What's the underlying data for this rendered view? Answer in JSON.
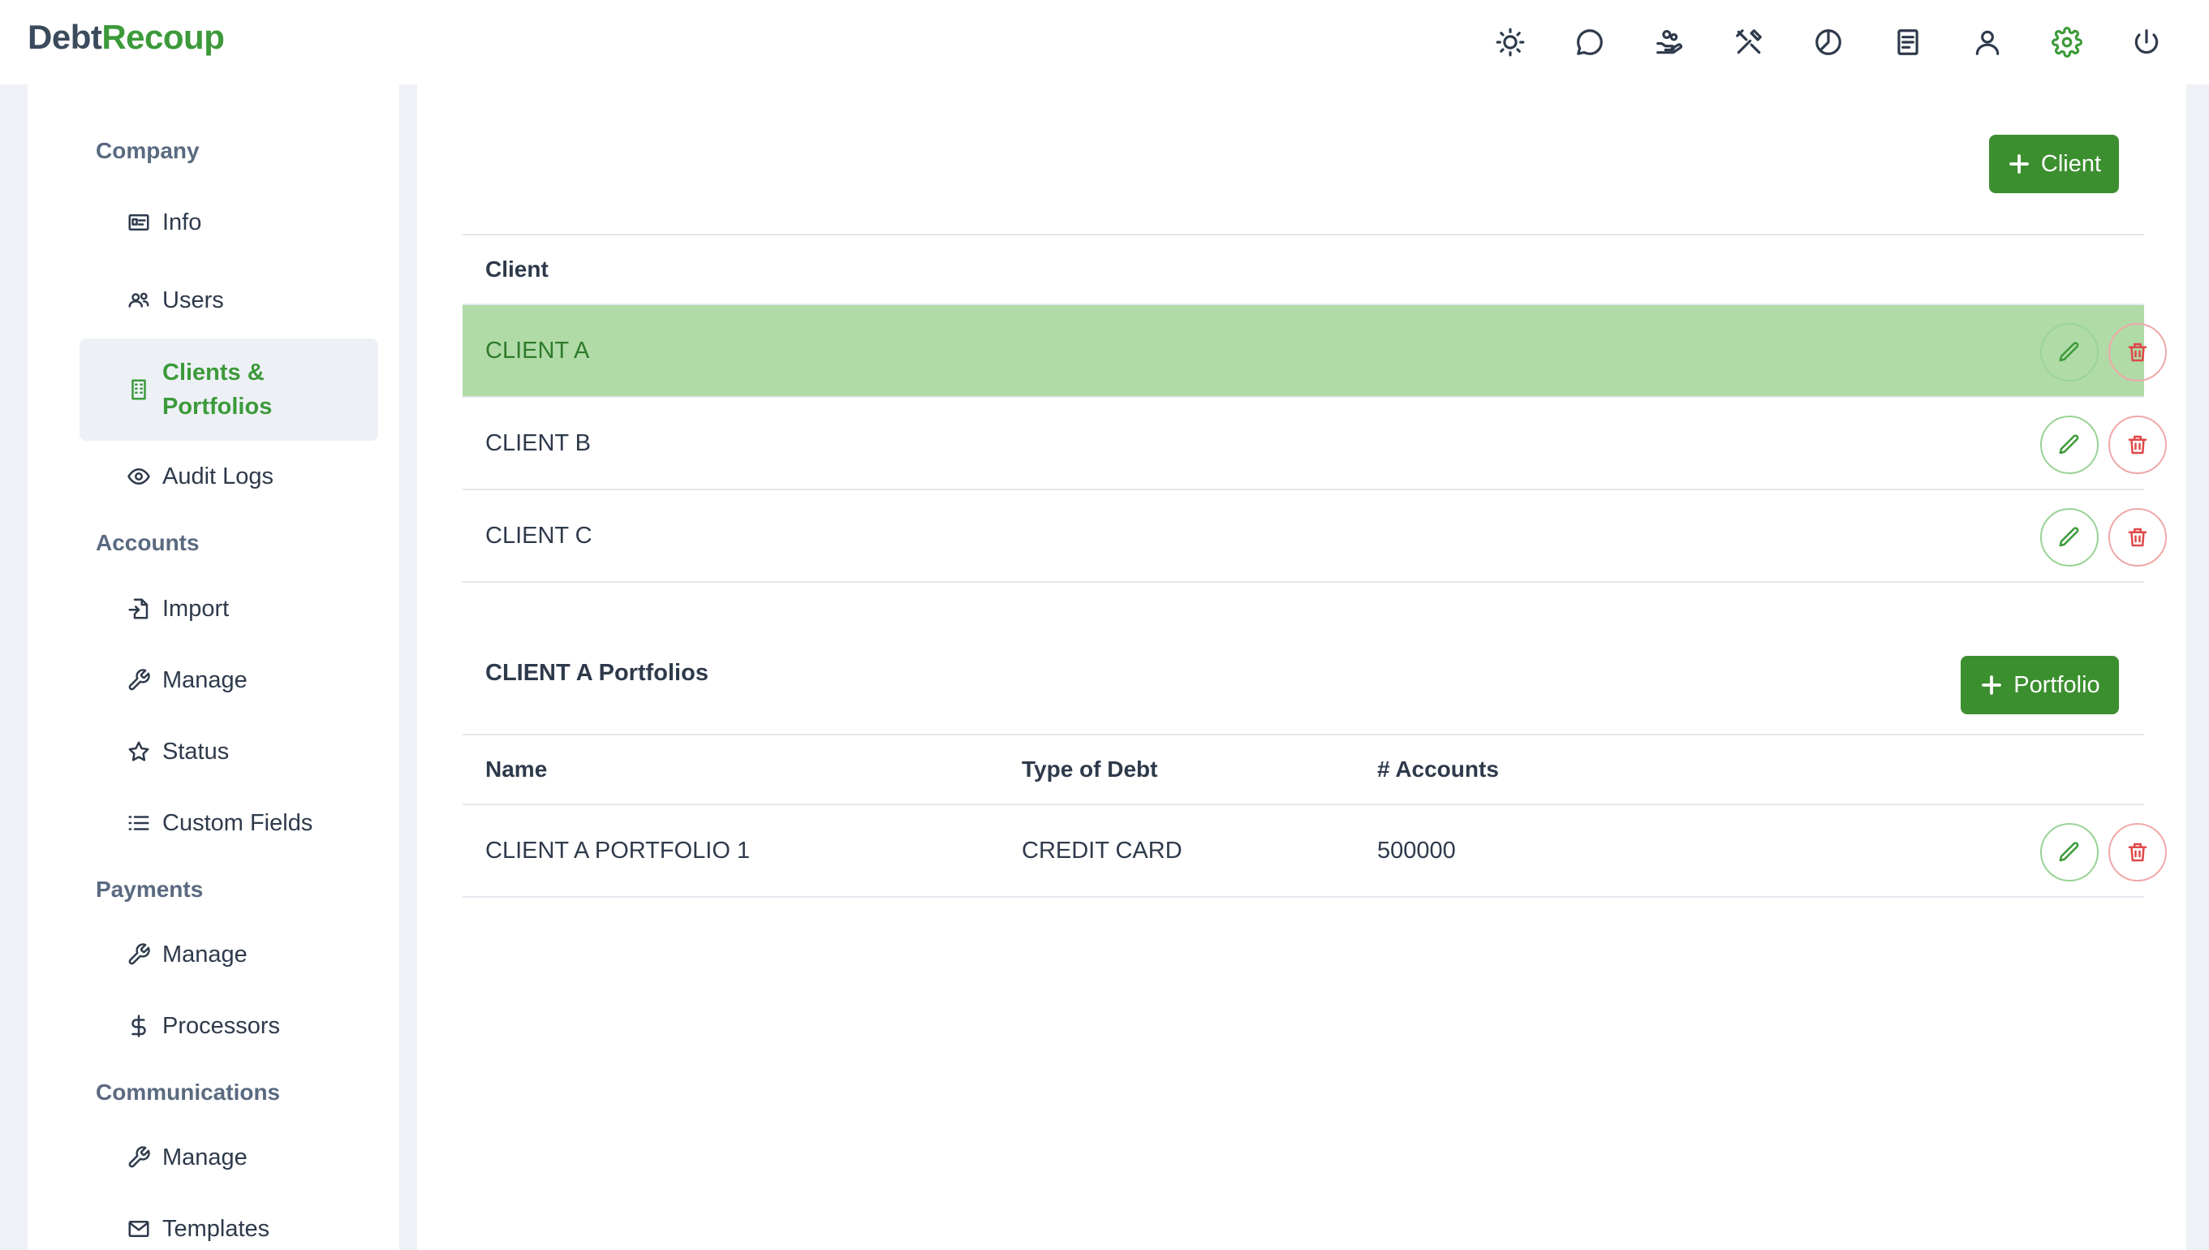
{
  "app": {
    "logo_part1": "Debt",
    "logo_part2": "Recoup"
  },
  "header_icons": [
    "sun-icon",
    "chat-icon",
    "hand-coins-icon",
    "tools-icon",
    "pie-chart-icon",
    "document-icon",
    "user-icon",
    "gear-icon",
    "power-icon"
  ],
  "colors": {
    "brand_green": "#3c9a3a",
    "button_green": "#3c8f2f",
    "selected_row": "#b0dba7",
    "delete_red": "#e04848"
  },
  "sidebar": {
    "company_title": "Company",
    "info": "Info",
    "users": "Users",
    "clients_portfolios": "Clients & Portfolios",
    "audit_logs": "Audit Logs",
    "accounts_title": "Accounts",
    "import": "Import",
    "accounts_manage": "Manage",
    "status": "Status",
    "custom_fields": "Custom Fields",
    "payments_title": "Payments",
    "payments_manage": "Manage",
    "processors": "Processors",
    "communications_title": "Communications",
    "communications_manage": "Manage",
    "templates": "Templates"
  },
  "clients": {
    "add_button": "Client",
    "column": "Client",
    "rows": [
      "CLIENT A",
      "CLIENT B",
      "CLIENT C"
    ],
    "selected": "CLIENT A"
  },
  "portfolios": {
    "title": "CLIENT A Portfolios",
    "add_button": "Portfolio",
    "columns": {
      "name": "Name",
      "type": "Type of Debt",
      "accounts": "# Accounts"
    },
    "rows": [
      {
        "name": "CLIENT A PORTFOLIO 1",
        "type": "CREDIT CARD",
        "accounts": "500000"
      }
    ]
  }
}
